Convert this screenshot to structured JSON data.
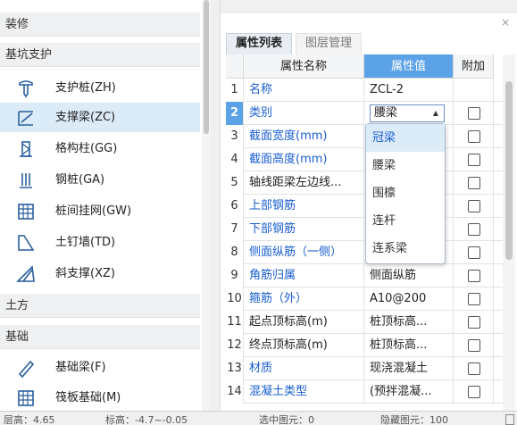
{
  "sidebar": {
    "categories": [
      "装修",
      "基坑支护",
      "土方",
      "基础"
    ],
    "items": [
      {
        "label": "支护桩(ZH)",
        "icon": "pile-icon"
      },
      {
        "label": "支撑梁(ZC)",
        "icon": "brace-beam-icon",
        "selected": true
      },
      {
        "label": "格构柱(GG)",
        "icon": "lattice-column-icon"
      },
      {
        "label": "钢桩(GA)",
        "icon": "steel-pile-icon"
      },
      {
        "label": "桩间挂网(GW)",
        "icon": "mesh-icon"
      },
      {
        "label": "土钉墙(TD)",
        "icon": "soil-nail-wall-icon"
      },
      {
        "label": "斜支撑(XZ)",
        "icon": "diagonal-brace-icon"
      },
      {
        "label": "基础梁(F)",
        "icon": "foundation-beam-icon"
      },
      {
        "label": "筏板基础(M)",
        "icon": "raft-foundation-icon"
      }
    ]
  },
  "panel": {
    "tabs": [
      "属性列表",
      "图层管理"
    ],
    "close": "×",
    "headers": {
      "name": "属性名称",
      "value": "属性值",
      "extra": "附加"
    },
    "rows": [
      {
        "num": "1",
        "name": "名称",
        "value": "ZCL-2",
        "blue": true,
        "check": false
      },
      {
        "num": "2",
        "name": "类别",
        "value": "腰梁",
        "blue": true,
        "check": true,
        "selected": true
      },
      {
        "num": "3",
        "name": "截面宽度(mm)",
        "value": "",
        "blue": true,
        "check": true
      },
      {
        "num": "4",
        "name": "截面高度(mm)",
        "value": "",
        "blue": true,
        "check": true
      },
      {
        "num": "5",
        "name": "轴线距梁左边线...",
        "value": "",
        "blue": false,
        "check": true
      },
      {
        "num": "6",
        "name": "上部钢筋",
        "value": "",
        "blue": true,
        "check": true
      },
      {
        "num": "7",
        "name": "下部钢筋",
        "value": "",
        "blue": true,
        "check": true
      },
      {
        "num": "8",
        "name": "侧面纵筋（一侧）",
        "value": "",
        "blue": true,
        "check": true
      },
      {
        "num": "9",
        "name": "角筋归属",
        "value": "侧面纵筋",
        "blue": true,
        "check": true
      },
      {
        "num": "10",
        "name": "箍筋（外）",
        "value": "A10@200",
        "blue": true,
        "check": true
      },
      {
        "num": "11",
        "name": "起点顶标高(m)",
        "value": "桩顶标高...",
        "blue": false,
        "check": true
      },
      {
        "num": "12",
        "name": "终点顶标高(m)",
        "value": "桩顶标高...",
        "blue": false,
        "check": true
      },
      {
        "num": "13",
        "name": "材质",
        "value": "现浇混凝土",
        "blue": true,
        "check": true
      },
      {
        "num": "14",
        "name": "混凝土类型",
        "value": "(预拌混凝...",
        "blue": true,
        "check": true
      }
    ],
    "dropdown": [
      "冠梁",
      "腰梁",
      "围檩",
      "连杆",
      "连系梁"
    ]
  },
  "status": {
    "floor_height": "层高：4.65",
    "elevation": "标高：-4.7~-0.05",
    "selected": "选中图元：0",
    "hidden": "隐藏图元：100"
  }
}
